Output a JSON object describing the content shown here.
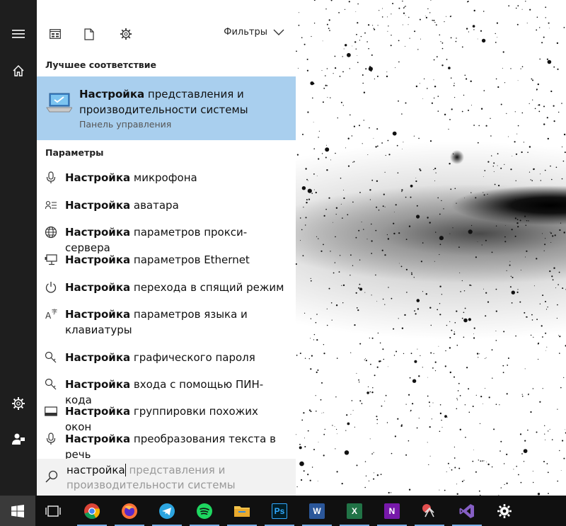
{
  "panel": {
    "filters_label": "Фильтры",
    "best_match_heading": "Лучшее соответствие",
    "best_match": {
      "bold": "Настройка",
      "rest": " представления и производительности системы",
      "subtitle": "Панель управления"
    },
    "settings_heading": "Параметры",
    "results": [
      {
        "icon": "microphone-icon",
        "bold": "Настройка",
        "rest": " микрофона"
      },
      {
        "icon": "avatar-icon",
        "bold": "Настройка",
        "rest": " аватара"
      },
      {
        "icon": "globe-icon",
        "bold": "Настройка",
        "rest": " параметров прокси-сервера"
      },
      {
        "icon": "ethernet-icon",
        "bold": "Настройка",
        "rest": " параметров Ethernet"
      },
      {
        "icon": "power-icon",
        "bold": "Настройка",
        "rest": " перехода в спящий режим"
      },
      {
        "icon": "language-icon",
        "bold": "Настройка",
        "rest": " параметров языка и клавиатуры"
      },
      {
        "icon": "key-icon",
        "bold": "Настройка",
        "rest": " графического пароля"
      },
      {
        "icon": "key-icon",
        "bold": "Настройка",
        "rest": " входа с помощью ПИН-кода"
      },
      {
        "icon": "window-snap-icon",
        "bold": "Настройка",
        "rest": " группировки похожих окон"
      },
      {
        "icon": "microphone-icon",
        "bold": "Настройка",
        "rest": " преобразования текста в речь"
      }
    ],
    "search": {
      "typed": "настройка",
      "suggestion": " представления и производительности системы"
    }
  },
  "rail": [
    "hamburger-icon",
    "home-icon",
    "settings-icon",
    "user-icon"
  ],
  "taskbar": {
    "apps": [
      {
        "name": "start",
        "icon": "windows-logo-icon"
      },
      {
        "name": "task-view",
        "icon": "task-view-icon"
      },
      {
        "name": "chrome",
        "icon": "chrome-icon"
      },
      {
        "name": "firefox",
        "icon": "firefox-icon"
      },
      {
        "name": "telegram",
        "icon": "telegram-icon"
      },
      {
        "name": "spotify",
        "icon": "spotify-icon"
      },
      {
        "name": "file-explorer",
        "icon": "folder-icon"
      },
      {
        "name": "photoshop",
        "icon": "photoshop-icon",
        "label": "Ps"
      },
      {
        "name": "word",
        "icon": "word-icon",
        "label": "W"
      },
      {
        "name": "excel",
        "icon": "excel-icon",
        "label": "X"
      },
      {
        "name": "onenote",
        "icon": "onenote-icon",
        "label": "N"
      },
      {
        "name": "snipping-tool",
        "icon": "snipping-tool-icon"
      },
      {
        "name": "visual-studio",
        "icon": "visual-studio-icon"
      },
      {
        "name": "settings",
        "icon": "settings-gear-icon"
      }
    ]
  },
  "colors": {
    "best_match_bg": "#a9cfee",
    "rail_bg": "#1e1e1e",
    "taskbar_bg": "#101010",
    "search_bg": "#f2f2f2"
  }
}
